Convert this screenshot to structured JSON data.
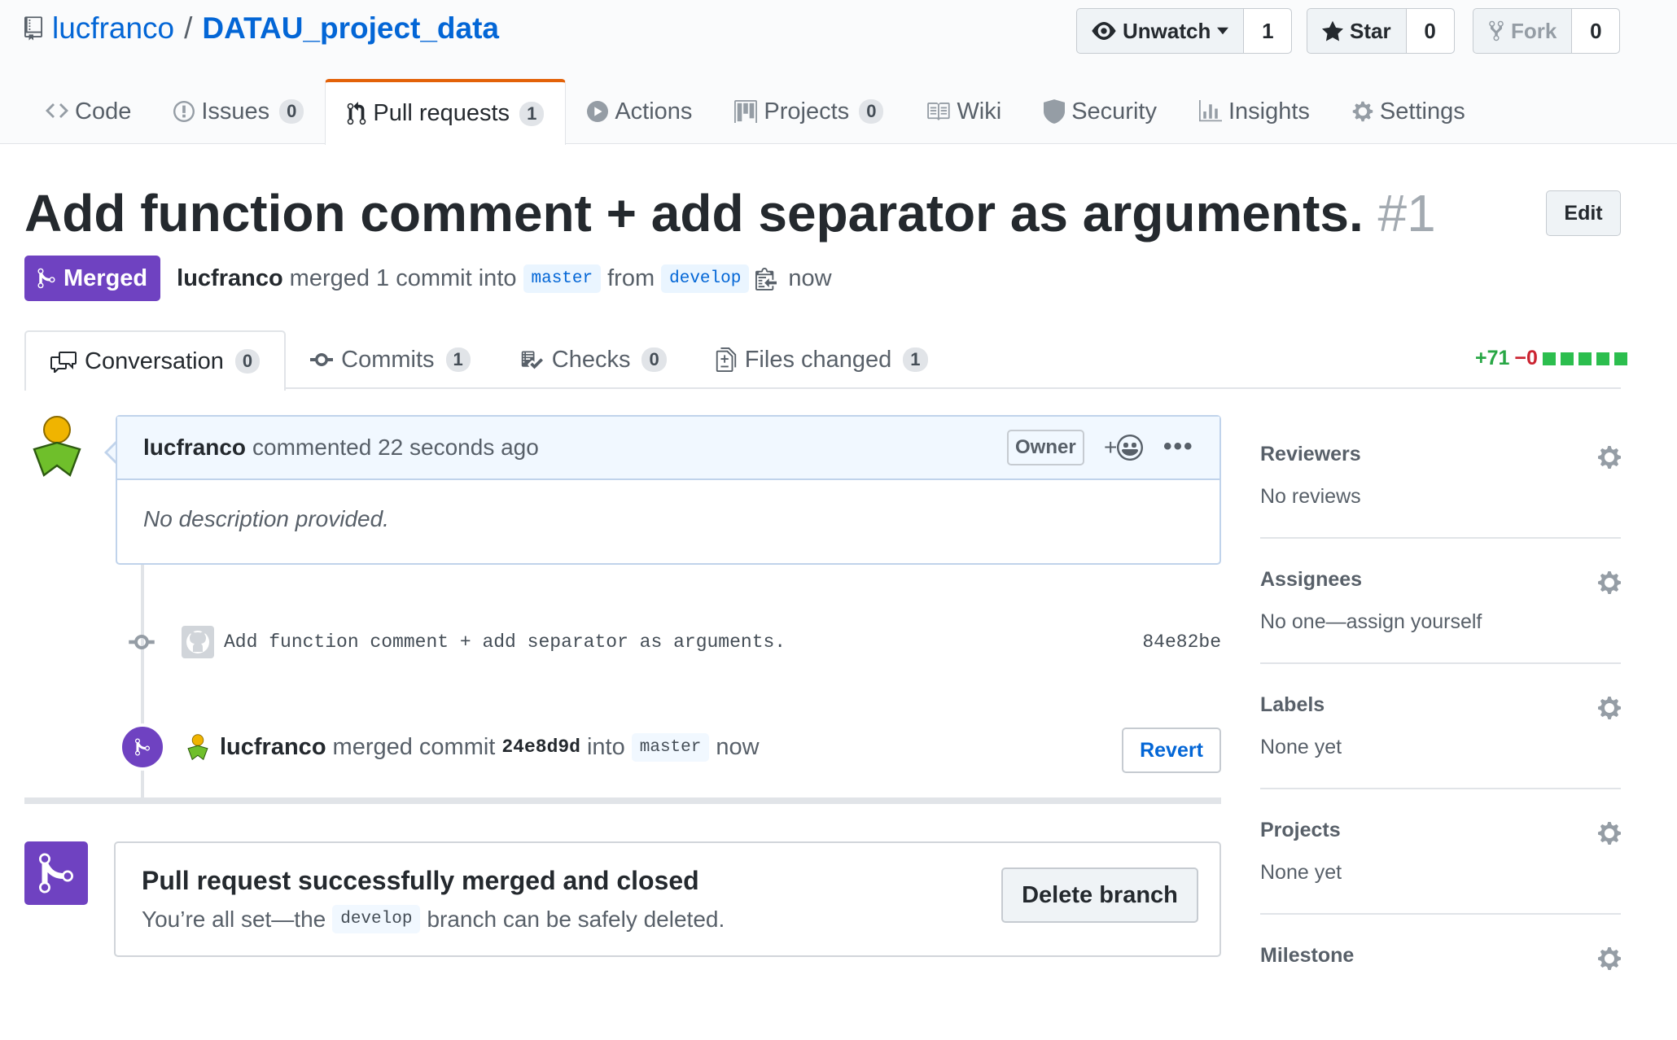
{
  "repo": {
    "owner": "lucfranco",
    "separator": "/",
    "name": "DATAU_project_data"
  },
  "actions": [
    {
      "label": "Unwatch",
      "count": "1"
    },
    {
      "label": "Star",
      "count": "0"
    },
    {
      "label": "Fork",
      "count": "0"
    }
  ],
  "tabs": [
    {
      "label": "Code",
      "icon": "code-icon"
    },
    {
      "label": "Issues",
      "count": "0",
      "icon": "issue-icon"
    },
    {
      "label": "Pull requests",
      "count": "1",
      "icon": "pull-request-icon"
    },
    {
      "label": "Actions",
      "icon": "play-icon"
    },
    {
      "label": "Projects",
      "count": "0",
      "icon": "project-icon"
    },
    {
      "label": "Wiki",
      "icon": "book-icon"
    },
    {
      "label": "Security",
      "icon": "shield-icon"
    },
    {
      "label": "Insights",
      "icon": "graph-icon"
    },
    {
      "label": "Settings",
      "icon": "gear-icon"
    }
  ],
  "pr": {
    "title": "Add function comment + add separator as arguments.",
    "number": "#1",
    "edit_label": "Edit",
    "state": "Merged",
    "author": "lucfranco",
    "merged_text": "merged 1 commit into",
    "base": "master",
    "from_text": "from",
    "head": "develop",
    "time": "now"
  },
  "subtabs": [
    {
      "label": "Conversation",
      "count": "0"
    },
    {
      "label": "Commits",
      "count": "1"
    },
    {
      "label": "Checks",
      "count": "0"
    },
    {
      "label": "Files changed",
      "count": "1"
    }
  ],
  "diffstat": {
    "additions": "+71",
    "deletions": "−0"
  },
  "comment": {
    "author": "lucfranco",
    "action": "commented 22 seconds ago",
    "badge": "Owner",
    "reaction": "+",
    "menu": "•••",
    "body": "No description provided."
  },
  "commit": {
    "message": "Add function comment + add separator as arguments.",
    "sha": "84e82be"
  },
  "merge_event": {
    "author": "lucfranco",
    "text": "merged commit",
    "sha": "24e8d9d",
    "into": "into",
    "base": "master",
    "time": "now",
    "revert_label": "Revert"
  },
  "merged_box": {
    "title": "Pull request successfully merged and closed",
    "prefix": "You’re all set—the",
    "branch": "develop",
    "suffix": "branch can be safely deleted.",
    "button": "Delete branch"
  },
  "sidebar": [
    {
      "heading": "Reviewers",
      "value": "No reviews"
    },
    {
      "heading": "Assignees",
      "value": "No one—assign yourself"
    },
    {
      "heading": "Labels",
      "value": "None yet"
    },
    {
      "heading": "Projects",
      "value": "None yet"
    },
    {
      "heading": "Milestone",
      "value": ""
    }
  ],
  "colors": {
    "merged": "#6f42c1",
    "link": "#0366d6",
    "added": "#28a745",
    "deleted": "#cb2431",
    "active_tab": "#e36209"
  }
}
